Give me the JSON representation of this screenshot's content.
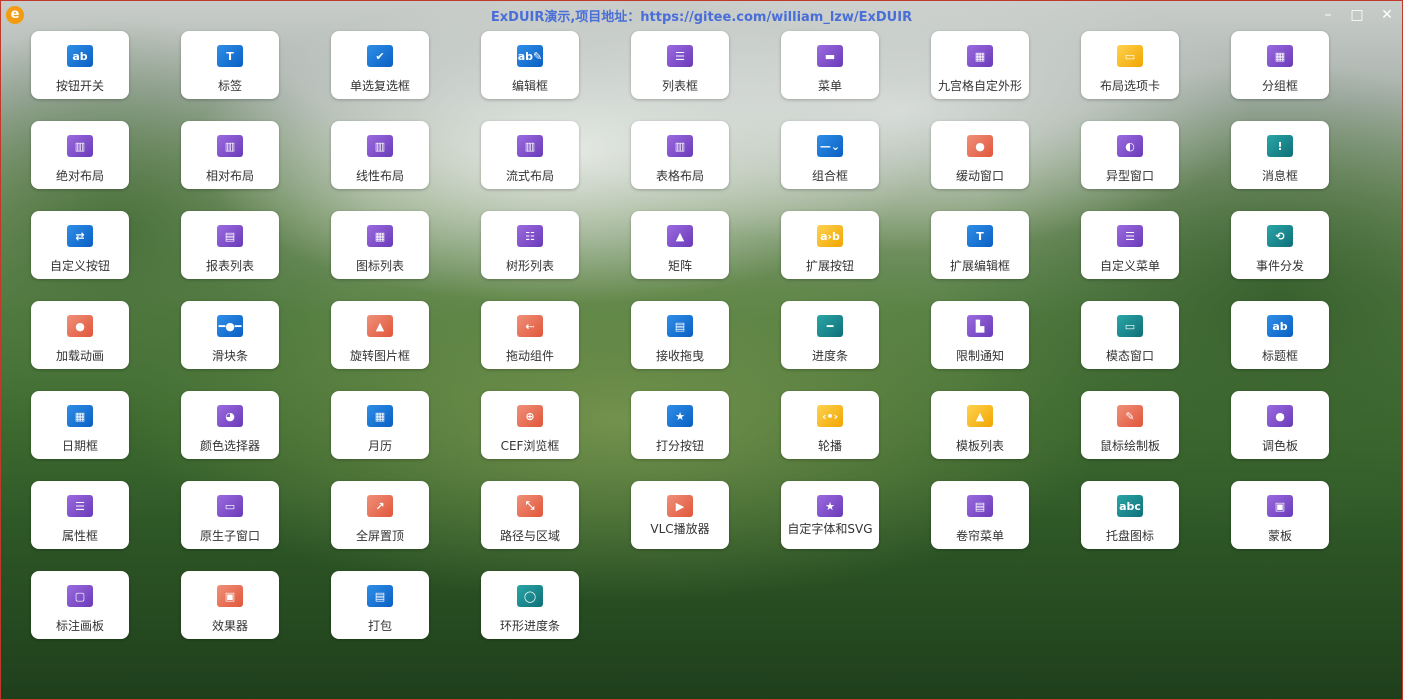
{
  "window": {
    "title": "ExDUIR演示,项目地址：https://gitee.com/william_lzw/ExDUIR",
    "logo_glyph": "e",
    "controls": {
      "minimize": "–",
      "maximize": "□",
      "close": "✕"
    }
  },
  "rows": [
    [
      {
        "label": "按钮开关",
        "icon": "ab-button-icon",
        "glyph": "ab",
        "color": "blue"
      },
      {
        "label": "标签",
        "icon": "label-t-icon",
        "glyph": "T",
        "color": "blue"
      },
      {
        "label": "单选复选框",
        "icon": "checkbox-icon",
        "glyph": "✔",
        "color": "blue"
      },
      {
        "label": "编辑框",
        "icon": "edit-box-icon",
        "glyph": "ab✎",
        "color": "blue"
      },
      {
        "label": "列表框",
        "icon": "listbox-icon",
        "glyph": "☰",
        "color": "purple"
      },
      {
        "label": "菜单",
        "icon": "menu-icon",
        "glyph": "▬",
        "color": "purple"
      },
      {
        "label": "九宫格自定外形",
        "icon": "nine-grid-icon",
        "glyph": "▦",
        "color": "purple"
      },
      {
        "label": "布局选项卡",
        "icon": "tab-layout-icon",
        "glyph": "▭",
        "color": "yellow"
      },
      {
        "label": "分组框",
        "icon": "groupbox-icon",
        "glyph": "▦",
        "color": "purple"
      }
    ],
    [
      {
        "label": "绝对布局",
        "icon": "absolute-layout-icon",
        "glyph": "▥",
        "color": "purple"
      },
      {
        "label": "相对布局",
        "icon": "relative-layout-icon",
        "glyph": "▥",
        "color": "purple"
      },
      {
        "label": "线性布局",
        "icon": "linear-layout-icon",
        "glyph": "▥",
        "color": "purple"
      },
      {
        "label": "流式布局",
        "icon": "flow-layout-icon",
        "glyph": "▥",
        "color": "purple"
      },
      {
        "label": "表格布局",
        "icon": "table-layout-icon",
        "glyph": "▥",
        "color": "purple"
      },
      {
        "label": "组合框",
        "icon": "combobox-icon",
        "glyph": "—⌄",
        "color": "blue"
      },
      {
        "label": "缓动窗口",
        "icon": "easing-window-icon",
        "glyph": "●",
        "color": "orange"
      },
      {
        "label": "异型窗口",
        "icon": "shaped-window-icon",
        "glyph": "◐",
        "color": "purple"
      },
      {
        "label": "消息框",
        "icon": "message-box-icon",
        "glyph": "!",
        "color": "teal"
      }
    ],
    [
      {
        "label": "自定义按钮",
        "icon": "custom-button-icon",
        "glyph": "⇄",
        "color": "blue"
      },
      {
        "label": "报表列表",
        "icon": "report-list-icon",
        "glyph": "▤",
        "color": "purple"
      },
      {
        "label": "图标列表",
        "icon": "icon-list-icon",
        "glyph": "▦",
        "color": "purple"
      },
      {
        "label": "树形列表",
        "icon": "tree-list-icon",
        "glyph": "☷",
        "color": "purple"
      },
      {
        "label": "矩阵",
        "icon": "matrix-icon",
        "glyph": "▲",
        "color": "purple"
      },
      {
        "label": "扩展按钮",
        "icon": "extended-button-icon",
        "glyph": "a›b",
        "color": "yellow"
      },
      {
        "label": "扩展编辑框",
        "icon": "extended-edit-icon",
        "glyph": "T",
        "color": "blue"
      },
      {
        "label": "自定义菜单",
        "icon": "custom-menu-icon",
        "glyph": "☰",
        "color": "purple"
      },
      {
        "label": "事件分发",
        "icon": "event-dispatch-icon",
        "glyph": "⟲",
        "color": "teal"
      }
    ],
    [
      {
        "label": "加载动画",
        "icon": "loading-animation-icon",
        "glyph": "●",
        "color": "orange"
      },
      {
        "label": "滑块条",
        "icon": "slider-icon",
        "glyph": "━●━",
        "color": "blue"
      },
      {
        "label": "旋转图片框",
        "icon": "rotate-image-icon",
        "glyph": "▲",
        "color": "orange"
      },
      {
        "label": "拖动组件",
        "icon": "drag-component-icon",
        "glyph": "⇠",
        "color": "orange"
      },
      {
        "label": "接收拖曳",
        "icon": "receive-drop-icon",
        "glyph": "▤",
        "color": "blue"
      },
      {
        "label": "进度条",
        "icon": "progress-bar-icon",
        "glyph": "━",
        "color": "teal"
      },
      {
        "label": "限制通知",
        "icon": "limit-notify-icon",
        "glyph": "▙",
        "color": "purple"
      },
      {
        "label": "模态窗口",
        "icon": "modal-window-icon",
        "glyph": "▭",
        "color": "teal"
      },
      {
        "label": "标题框",
        "icon": "title-box-icon",
        "glyph": "ab",
        "color": "blue"
      }
    ],
    [
      {
        "label": "日期框",
        "icon": "date-box-icon",
        "glyph": "▦",
        "color": "blue"
      },
      {
        "label": "颜色选择器",
        "icon": "color-picker-icon",
        "glyph": "◕",
        "color": "purple"
      },
      {
        "label": "月历",
        "icon": "calendar-icon",
        "glyph": "▦",
        "color": "blue"
      },
      {
        "label": "CEF浏览框",
        "icon": "globe-icon",
        "glyph": "⊕",
        "color": "orange"
      },
      {
        "label": "打分按钮",
        "icon": "star-icon",
        "glyph": "★",
        "color": "blue"
      },
      {
        "label": "轮播",
        "icon": "carousel-icon",
        "glyph": "‹•›",
        "color": "yellow"
      },
      {
        "label": "模板列表",
        "icon": "template-list-icon",
        "glyph": "▲",
        "color": "yellow"
      },
      {
        "label": "鼠标绘制板",
        "icon": "draw-board-icon",
        "glyph": "✎",
        "color": "orange"
      },
      {
        "label": "调色板",
        "icon": "palette-icon",
        "glyph": "●",
        "color": "purple"
      }
    ],
    [
      {
        "label": "属性框",
        "icon": "property-box-icon",
        "glyph": "☰",
        "color": "purple"
      },
      {
        "label": "原生子窗口",
        "icon": "native-child-window-icon",
        "glyph": "▭",
        "color": "purple"
      },
      {
        "label": "全屏置顶",
        "icon": "fullscreen-top-icon",
        "glyph": "↗",
        "color": "orange"
      },
      {
        "label": "路径与区域",
        "icon": "path-region-icon",
        "glyph": "⤡",
        "color": "orange"
      },
      {
        "label": "VLC播放器",
        "icon": "vlc-player-icon",
        "glyph": "▶",
        "color": "orange",
        "two_line": true
      },
      {
        "label": "自定字体和SVG",
        "icon": "font-svg-icon",
        "glyph": "★",
        "color": "purple",
        "two_line": true
      },
      {
        "label": "卷帘菜单",
        "icon": "roller-menu-icon",
        "glyph": "▤",
        "color": "purple"
      },
      {
        "label": "托盘图标",
        "icon": "tray-icon",
        "glyph": "abc",
        "color": "teal"
      },
      {
        "label": "蒙板",
        "icon": "mask-icon",
        "glyph": "▣",
        "color": "purple"
      }
    ],
    [
      {
        "label": "标注画板",
        "icon": "annotation-board-icon",
        "glyph": "▢",
        "color": "purple"
      },
      {
        "label": "效果器",
        "icon": "effector-icon",
        "glyph": "▣",
        "color": "orange"
      },
      {
        "label": "打包",
        "icon": "package-icon",
        "glyph": "▤",
        "color": "blue"
      },
      {
        "label": "环形进度条",
        "icon": "ring-progress-icon",
        "glyph": "◯",
        "color": "teal"
      }
    ]
  ]
}
